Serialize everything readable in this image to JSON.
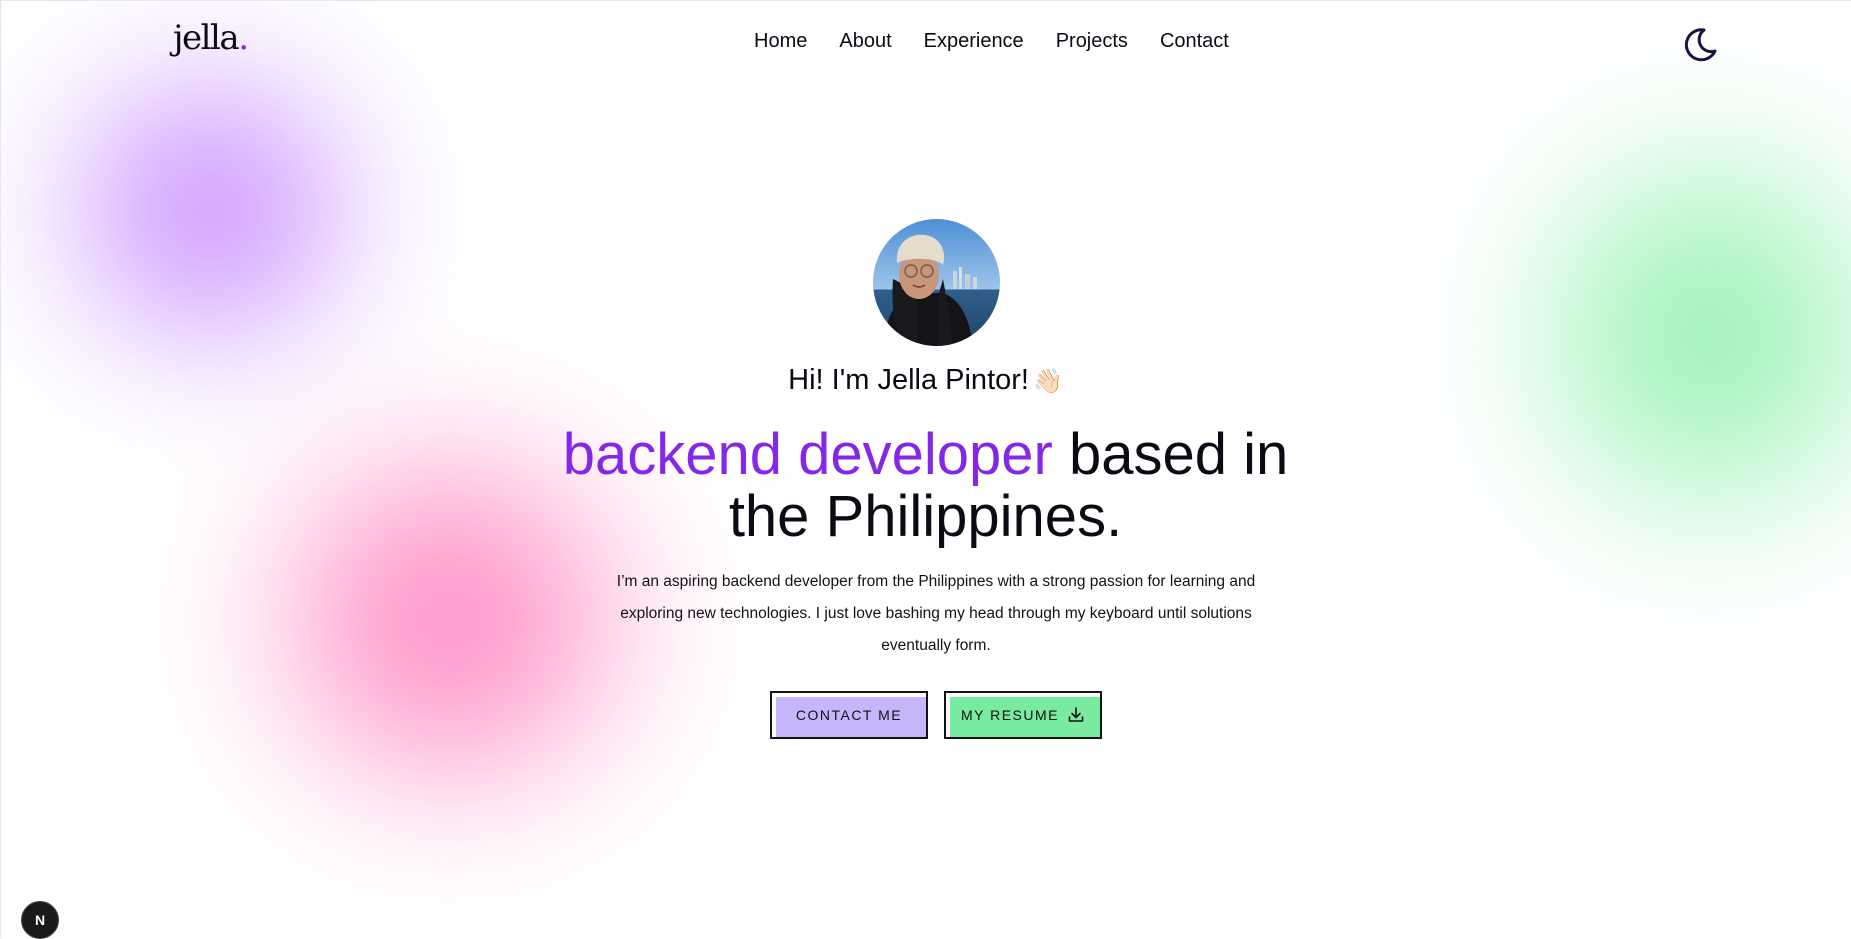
{
  "brand": {
    "logo_text": "jella",
    "logo_dot": "."
  },
  "nav": {
    "items": [
      {
        "label": "Home"
      },
      {
        "label": "About"
      },
      {
        "label": "Experience"
      },
      {
        "label": "Projects"
      },
      {
        "label": "Contact"
      }
    ]
  },
  "theme_toggle": {
    "icon": "moon-icon"
  },
  "hero": {
    "avatar_alt": "profile photo",
    "greeting": "Hi! I'm Jella Pintor!",
    "greeting_emoji": "👋🏻",
    "headline_accent": "backend developer",
    "headline_rest_line1": " based in",
    "headline_line2": "the Philippines.",
    "description": "I’m an aspiring backend developer from the Philippines with a strong passion for learning and exploring new technologies. I just love bashing my head through my keyboard until solutions eventually form.",
    "buttons": {
      "contact_label": "CONTACT ME",
      "resume_label": "MY RESUME",
      "resume_icon": "download-icon"
    }
  },
  "colors": {
    "accent_purple": "#8427e6",
    "contact_button": "#c7b5fb",
    "resume_button": "#79eba0",
    "blob_purple": "#c07cfd",
    "blob_pink": "#ff79bd",
    "blob_green": "#8ef0ad"
  },
  "dev_badge": {
    "label": "N"
  }
}
